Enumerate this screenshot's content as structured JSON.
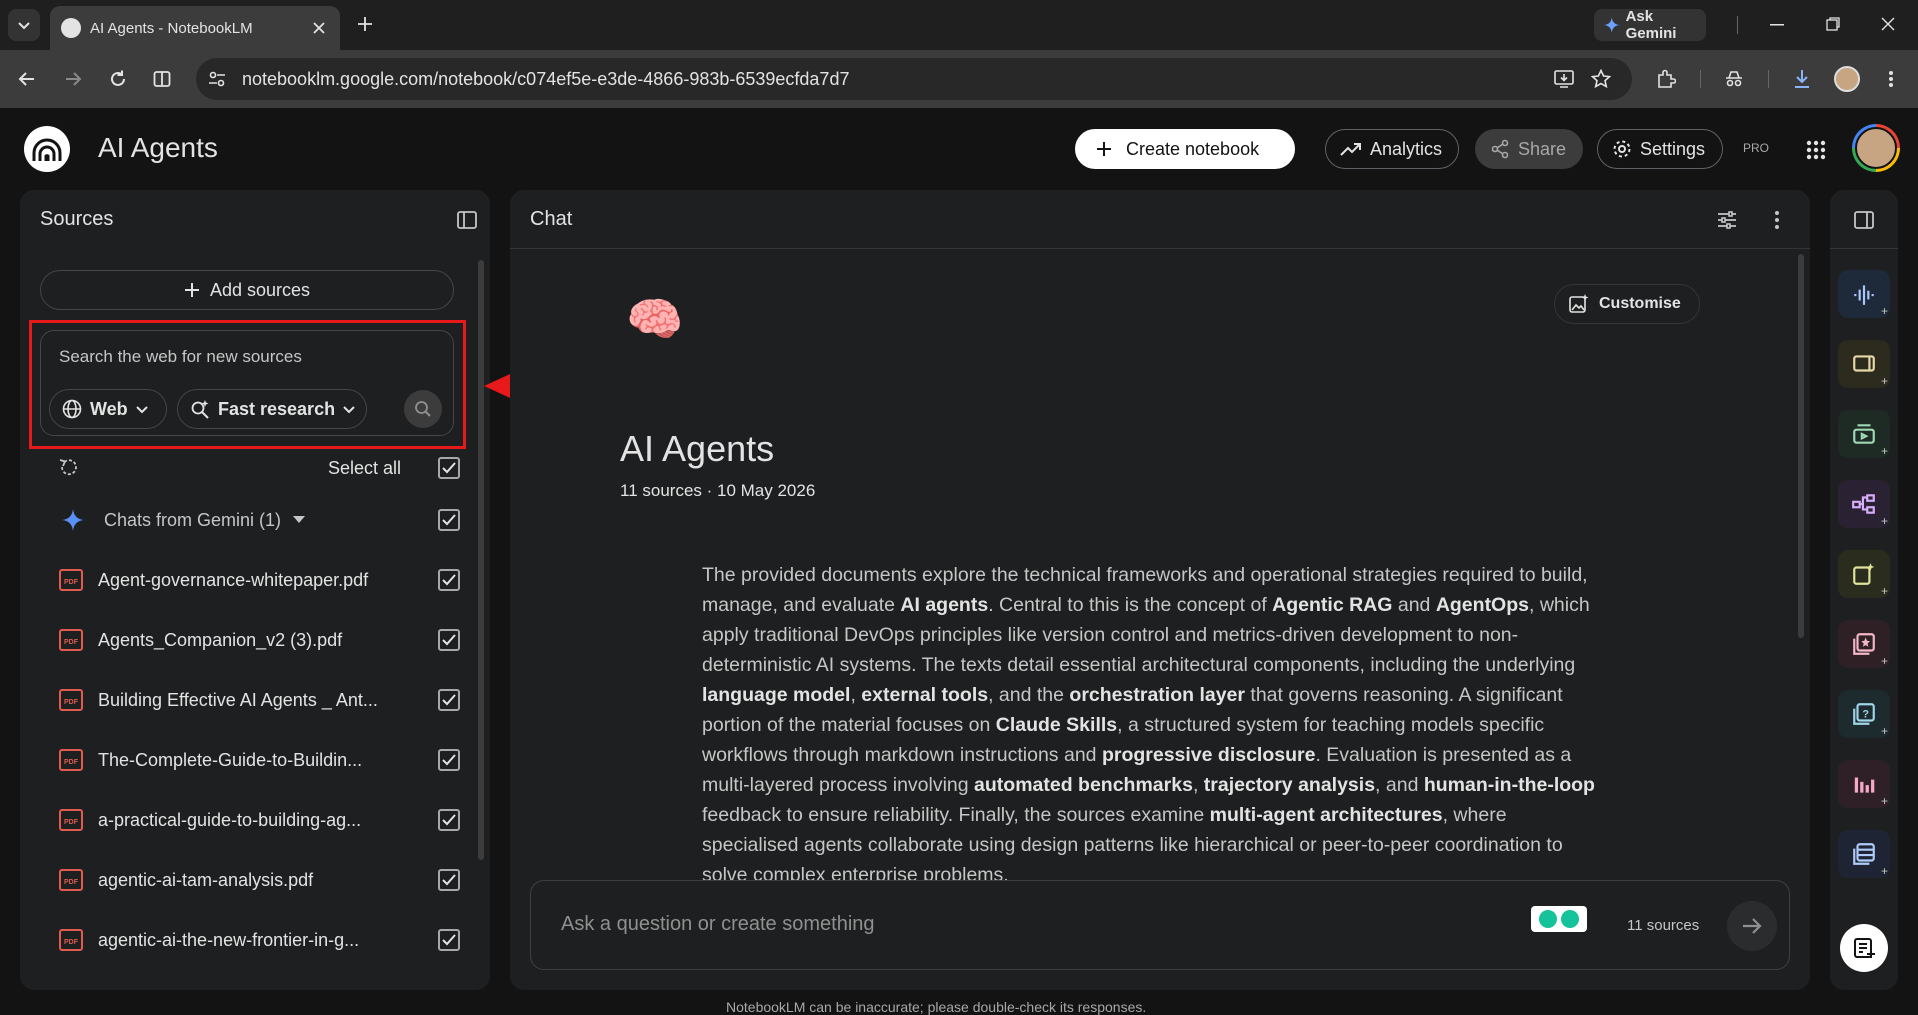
{
  "browser": {
    "tab_title": "AI Agents - NotebookLM",
    "ask_gemini": "Ask Gemini",
    "url": "notebooklm.google.com/notebook/c074ef5e-e3de-4866-983b-6539ecfda7d7"
  },
  "header": {
    "title": "AI Agents",
    "create_notebook": "Create notebook",
    "analytics": "Analytics",
    "share": "Share",
    "settings": "Settings",
    "pro_badge": "PRO"
  },
  "sources": {
    "title": "Sources",
    "add_sources": "Add sources",
    "search_placeholder": "Search the web for new sources",
    "web_dropdown": "Web",
    "research_dropdown": "Fast research",
    "select_all": "Select all",
    "gemini_group": "Chats from Gemini (1)",
    "items": [
      {
        "name": "Agent-governance-whitepaper.pdf"
      },
      {
        "name": "Agents_Companion_v2 (3).pdf"
      },
      {
        "name": "Building Effective AI Agents _ Ant..."
      },
      {
        "name": "The-Complete-Guide-to-Buildin..."
      },
      {
        "name": "a-practical-guide-to-building-ag..."
      },
      {
        "name": "agentic-ai-tam-analysis.pdf"
      },
      {
        "name": "agentic-ai-the-new-frontier-in-g..."
      }
    ]
  },
  "chat": {
    "title": "Chat",
    "customise": "Customise",
    "emoji": "🧠",
    "notebook_title": "AI Agents",
    "meta": "11 sources · 10 May 2026",
    "summary_parts": [
      {
        "t": "The provided documents explore the technical frameworks and operational strategies required to build, manage, and evaluate ",
        "b": false
      },
      {
        "t": "AI agents",
        "b": true
      },
      {
        "t": ". Central to this is the concept of ",
        "b": false
      },
      {
        "t": "Agentic RAG",
        "b": true
      },
      {
        "t": " and ",
        "b": false
      },
      {
        "t": "AgentOps",
        "b": true
      },
      {
        "t": ", which apply traditional DevOps principles like version control and metrics-driven development to non-deterministic AI systems. The texts detail essential architectural components, including the underlying ",
        "b": false
      },
      {
        "t": "language model",
        "b": true
      },
      {
        "t": ", ",
        "b": false
      },
      {
        "t": "external tools",
        "b": true
      },
      {
        "t": ", and the ",
        "b": false
      },
      {
        "t": "orchestration layer",
        "b": true
      },
      {
        "t": " that governs reasoning. A significant portion of the material focuses on ",
        "b": false
      },
      {
        "t": "Claude Skills",
        "b": true
      },
      {
        "t": ", a structured system for teaching models specific workflows through markdown instructions and ",
        "b": false
      },
      {
        "t": "progressive disclosure",
        "b": true
      },
      {
        "t": ". Evaluation is presented as a multi-layered process involving ",
        "b": false
      },
      {
        "t": "automated benchmarks",
        "b": true
      },
      {
        "t": ", ",
        "b": false
      },
      {
        "t": "trajectory analysis",
        "b": true
      },
      {
        "t": ", and ",
        "b": false
      },
      {
        "t": "human-in-the-loop",
        "b": true
      },
      {
        "t": " feedback to ensure reliability. Finally, the sources examine ",
        "b": false
      },
      {
        "t": "multi-agent architectures",
        "b": true
      },
      {
        "t": ", where specialised agents collaborate using design patterns like hierarchical or peer-to-peer coordination to solve complex enterprise problems.",
        "b": false
      }
    ],
    "input_placeholder": "Ask a question or create something",
    "source_count": "11 sources"
  },
  "footer": {
    "disclaimer": "NotebookLM can be inaccurate; please double-check its responses."
  },
  "colors": {
    "annotation_red": "#e8191a",
    "studio_audio": "#1e2a3a",
    "studio_video": "#2d2a1e"
  }
}
